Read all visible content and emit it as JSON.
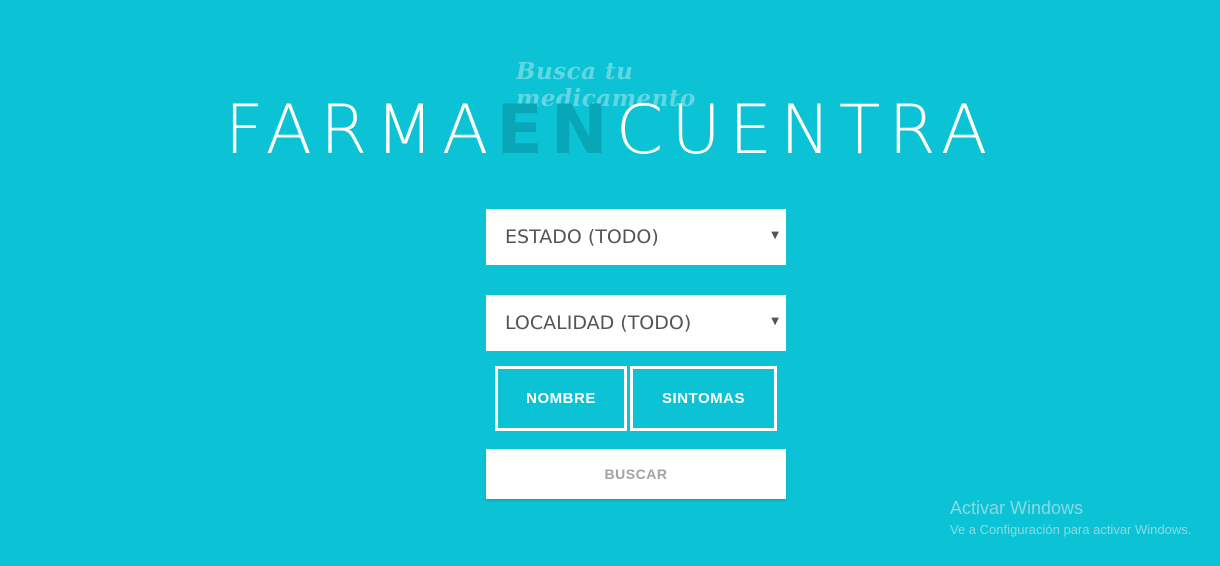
{
  "brand": {
    "tagline": "Busca tu medicamento",
    "logo_part1": "FARMA",
    "logo_accent": "EN",
    "logo_part2": "CUENTRA"
  },
  "filters": {
    "estado": "ESTADO (TODO)",
    "localidad": "LOCALIDAD (TODO)"
  },
  "search_modes": {
    "nombre": "NOMBRE",
    "sintomas": "SINTOMAS"
  },
  "actions": {
    "buscar": "BUSCAR"
  },
  "watermark": {
    "title": "Activar Windows",
    "subtitle": "Ve a Configuración para activar Windows."
  },
  "icons": {
    "dropdown": "caret-down-icon"
  },
  "colors": {
    "background": "#0bc3d4",
    "accent": "#08a6b7",
    "tagline": "#62d6e2"
  }
}
